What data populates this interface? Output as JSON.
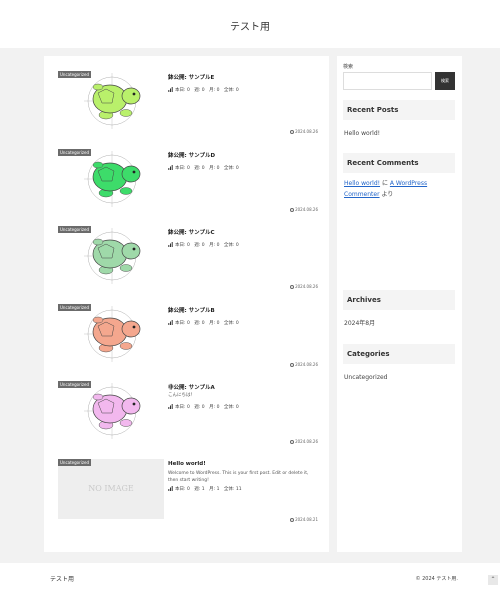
{
  "site": {
    "title": "テスト用"
  },
  "colors": {
    "page_bg": "#f2f2f2",
    "category_badge": "#6b6b6b",
    "search_button": "#333333",
    "link": "#2265c9"
  },
  "posts": [
    {
      "category": "Uncategorized",
      "title": "鉢公開: サンプルE",
      "excerpt": "",
      "stats": "本日: 0　週: 0　月: 0　全体: 0",
      "date": "2024.08.26",
      "thumbnail_color": "#b9f06b"
    },
    {
      "category": "Uncategorized",
      "title": "鉢公開: サンプルD",
      "excerpt": "",
      "stats": "本日: 0　週: 0　月: 0　全体: 0",
      "date": "2024.08.26",
      "thumbnail_color": "#3ddc6a"
    },
    {
      "category": "Uncategorized",
      "title": "鉢公開: サンプルC",
      "excerpt": "",
      "stats": "本日: 0　週: 0　月: 0　全体: 0",
      "date": "2024.08.26",
      "thumbnail_color": "#9fd9a9"
    },
    {
      "category": "Uncategorized",
      "title": "鉢公開: サンプルB",
      "excerpt": "",
      "stats": "本日: 0　週: 0　月: 0　全体: 0",
      "date": "2024.08.26",
      "thumbnail_color": "#f4a78e"
    },
    {
      "category": "Uncategorized",
      "title": "非公開: サンプルA",
      "excerpt": "こんにちは！",
      "stats": "本日: 0　週: 0　月: 0　全体: 0",
      "date": "2024.08.26",
      "thumbnail_color": "#f2b8ee"
    },
    {
      "category": "Uncategorized",
      "title": "Hello world!",
      "excerpt": "Welcome to WordPress. This is your first post. Edit or delete it, then start writing!",
      "stats": "本日: 0　週: 1　月: 1　全体: 11",
      "date": "2024.08.21",
      "no_image_text": "NO IMAGE"
    }
  ],
  "sidebar": {
    "search_label": "検索",
    "search_placeholder": "",
    "search_button": "検索",
    "recent_posts_title": "Recent Posts",
    "recent_posts": [
      "Hello world!"
    ],
    "recent_comments_title": "Recent Comments",
    "comment_post_link": "Hello world!",
    "comment_mid": " に ",
    "comment_author_link": "A WordPress Commenter",
    "comment_suffix": " より",
    "archives_title": "Archives",
    "archives": [
      "2024年8月"
    ],
    "categories_title": "Categories",
    "categories": [
      "Uncategorized"
    ]
  },
  "footer": {
    "title": "テスト用",
    "copyright": "© 2024 テスト用."
  }
}
